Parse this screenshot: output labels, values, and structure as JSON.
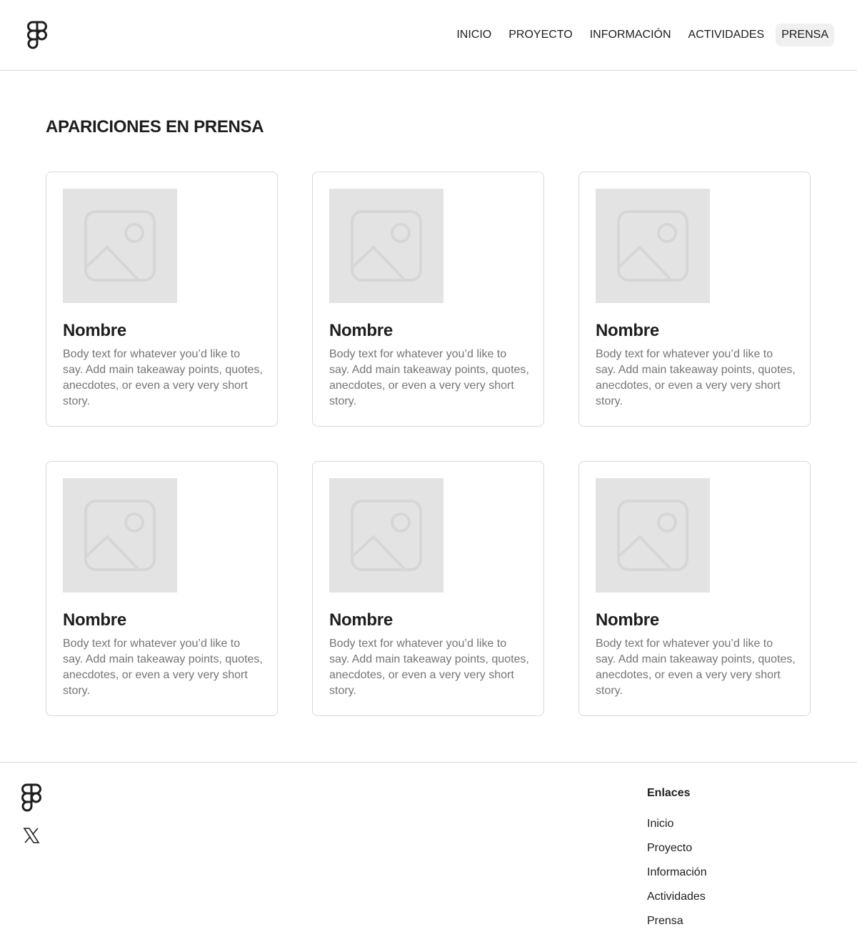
{
  "header": {
    "logo_icon": "figma-logo-icon",
    "nav": [
      {
        "label": "INICIO"
      },
      {
        "label": "PROYECTO"
      },
      {
        "label": "INFORMACIÓN"
      },
      {
        "label": "ACTIVIDADES"
      },
      {
        "label": "PRENSA",
        "active": true
      }
    ]
  },
  "main": {
    "title": "APARICIONES EN PRENSA",
    "cards": [
      {
        "image_icon": "image-placeholder-icon",
        "title": "Nombre",
        "body": "Body text for whatever you’d like to say. Add main takeaway points, quotes, anecdotes, or even a very very short story."
      },
      {
        "image_icon": "image-placeholder-icon",
        "title": "Nombre",
        "body": "Body text for whatever you’d like to say. Add main takeaway points, quotes, anecdotes, or even a very very short story."
      },
      {
        "image_icon": "image-placeholder-icon",
        "title": "Nombre",
        "body": "Body text for whatever you’d like to say. Add main takeaway points, quotes, anecdotes, or even a very very short story."
      },
      {
        "image_icon": "image-placeholder-icon",
        "title": "Nombre",
        "body": "Body text for whatever you’d like to say. Add main takeaway points, quotes, anecdotes, or even a very very short story."
      },
      {
        "image_icon": "image-placeholder-icon",
        "title": "Nombre",
        "body": "Body text for whatever you’d like to say. Add main takeaway points, quotes, anecdotes, or even a very very short story."
      },
      {
        "image_icon": "image-placeholder-icon",
        "title": "Nombre",
        "body": "Body text for whatever you’d like to say. Add main takeaway points, quotes, anecdotes, or even a very very short story."
      }
    ]
  },
  "footer": {
    "logo_icon": "figma-logo-icon",
    "social_icon": "x-icon",
    "links_heading": "Enlaces",
    "links": [
      {
        "label": "Inicio"
      },
      {
        "label": "Proyecto"
      },
      {
        "label": "Información"
      },
      {
        "label": "Actividades"
      },
      {
        "label": "Prensa"
      }
    ]
  },
  "colors": {
    "text": "#1e1e1e",
    "muted_text": "#757575",
    "border": "#d9d9d9",
    "placeholder_bg": "#e3e3e3",
    "active_nav_bg": "#f0f0f0"
  }
}
